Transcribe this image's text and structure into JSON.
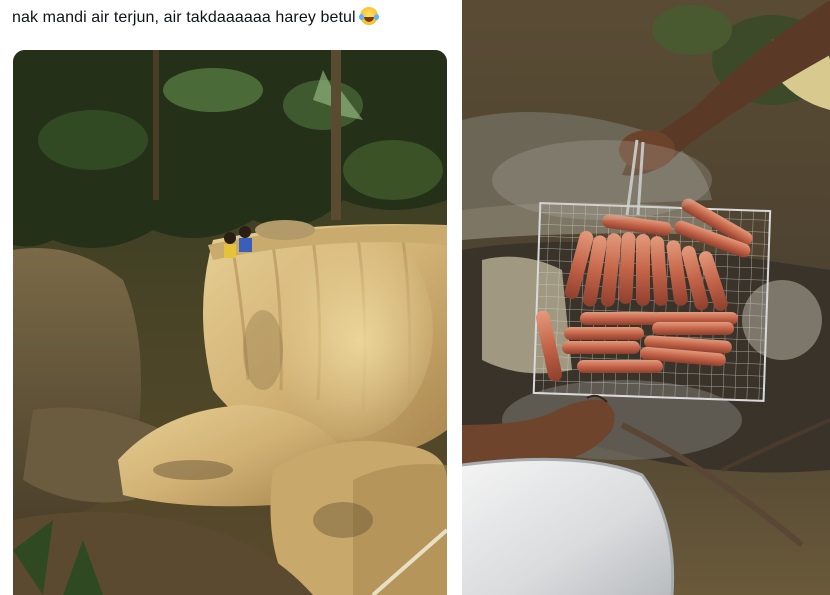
{
  "tweet": {
    "text": "nak mandi air terjun, air takdaaaaaa harey betul",
    "emoji_icon": "face-with-tears-of-joy-icon"
  },
  "media": {
    "left_photo": "dry-waterfall-rock-photo",
    "right_photo": "sausages-on-grill-photo"
  }
}
